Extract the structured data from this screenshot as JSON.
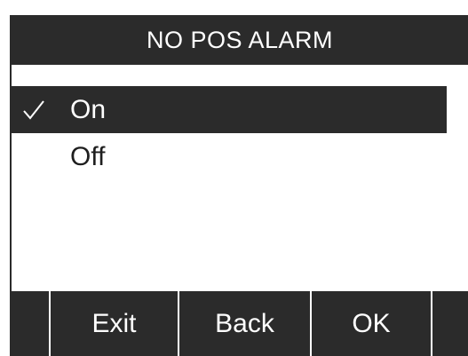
{
  "screen": {
    "title": "NO POS ALARM"
  },
  "menu": {
    "items": [
      {
        "label": "On",
        "selected": true,
        "checked": true,
        "check_icon": "check-icon"
      },
      {
        "label": "Off",
        "selected": false,
        "checked": false
      }
    ]
  },
  "softkeys": [
    {
      "label": ""
    },
    {
      "label": "Exit"
    },
    {
      "label": "Back"
    },
    {
      "label": "OK"
    },
    {
      "label": ""
    }
  ],
  "colors": {
    "bar_background": "#2b2b2b",
    "bar_text": "#ffffff",
    "screen_background": "#ffffff",
    "item_text": "#1e1e1e"
  }
}
